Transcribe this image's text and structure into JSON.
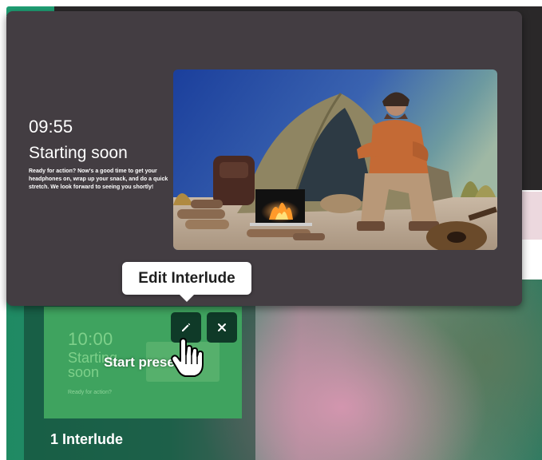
{
  "interlude_preview": {
    "timer": "09:55",
    "title": "Starting soon",
    "message": "Ready for action? Now's a good time to get your headphones on, wrap up your snack, and do a quick stretch. We look forward to seeing you shortly!"
  },
  "tooltip": {
    "label": "Edit Interlude"
  },
  "thumbnail": {
    "timer": "10:00",
    "title": "Starting soon",
    "message": "Ready for action?",
    "hover_label": "Start presen"
  },
  "buttons": {
    "edit_icon": "pencil-icon",
    "close_icon": "close-icon"
  },
  "footer": {
    "interlude_count": "1 Interlude"
  },
  "colors": {
    "accent_green": "#1f9f74",
    "thumbnail_green": "#3fa35f",
    "button_dark": "#0f3a28",
    "preview_bg": "#433d42"
  }
}
